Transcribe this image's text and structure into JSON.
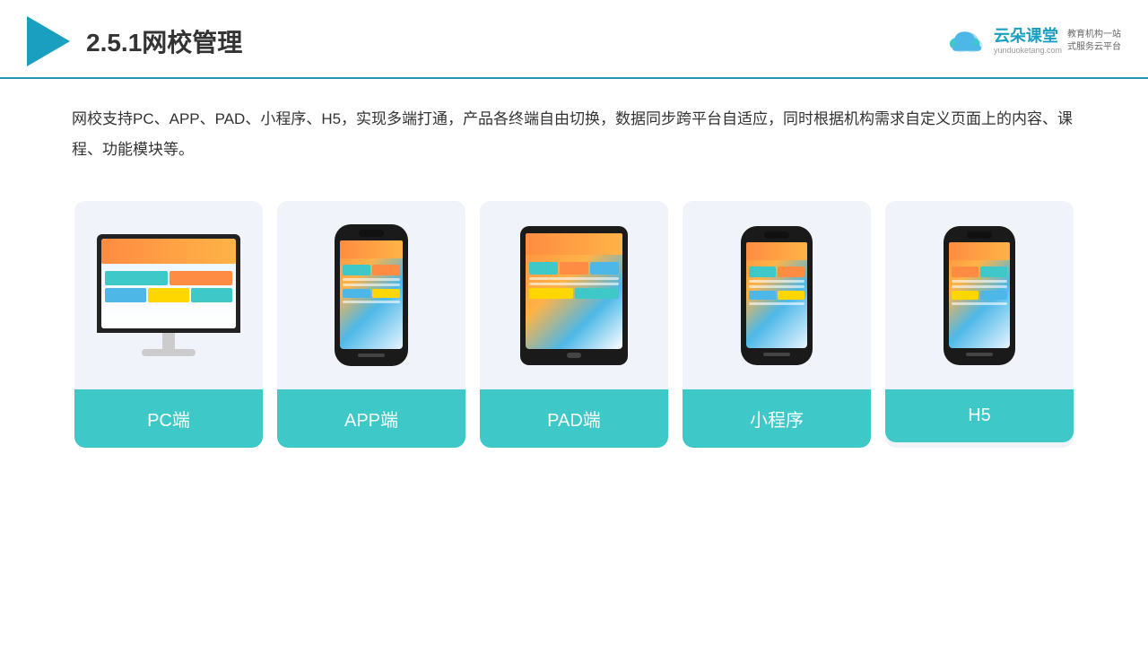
{
  "header": {
    "title": "2.5.1网校管理",
    "brand": {
      "name": "云朵课堂",
      "url": "yunduoketang.com",
      "slogan": "教育机构一站\n式服务云平台"
    }
  },
  "description": "网校支持PC、APP、PAD、小程序、H5，实现多端打通，产品各终端自由切换，数据同步跨平台自适应，同时根据机构需求自定义页面上的内容、课程、功能模块等。",
  "cards": [
    {
      "id": "pc",
      "label": "PC端"
    },
    {
      "id": "app",
      "label": "APP端"
    },
    {
      "id": "pad",
      "label": "PAD端"
    },
    {
      "id": "miniapp",
      "label": "小程序"
    },
    {
      "id": "h5",
      "label": "H5"
    }
  ]
}
